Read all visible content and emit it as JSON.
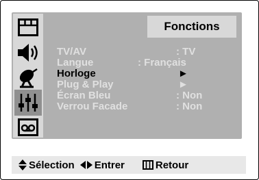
{
  "menu": {
    "title": "Fonctions",
    "items": [
      {
        "label": "TV/AV",
        "value": ": TV"
      },
      {
        "label": "Langue",
        "value": ": Français"
      },
      {
        "label": "Horloge",
        "value": "►"
      },
      {
        "label": "Plug & Play",
        "value": "►"
      },
      {
        "label": "Écran Bleu",
        "value": ": Non"
      },
      {
        "label": "Verrou Facade",
        "value": ": Non"
      }
    ],
    "active_item": "Horloge"
  },
  "sidebar": {
    "icons": [
      "picture-icon",
      "sound-icon",
      "channel-antenna-icon",
      "function-sliders-icon",
      "tape-icon"
    ],
    "selected": "function-sliders-icon"
  },
  "footer": {
    "select": "Sélection",
    "enter": "Entrer",
    "back": "Retour"
  },
  "colors": {
    "panel": "#b0b0b0",
    "rail": "#d8d8d8",
    "selected_icon_bg": "#909090",
    "inactive_text": "#e0e0e0",
    "active_text": "#000000"
  }
}
